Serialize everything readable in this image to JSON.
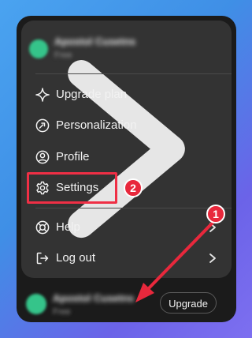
{
  "account": {
    "name": "Apostol Cusetns",
    "plan": "Free"
  },
  "menu": {
    "items": [
      {
        "id": "upgrade",
        "label": "Upgrade plan",
        "icon": "sparkle-icon"
      },
      {
        "id": "personalization",
        "label": "Personalization",
        "icon": "personalization-icon"
      },
      {
        "id": "profile",
        "label": "Profile",
        "icon": "user-icon"
      },
      {
        "id": "settings",
        "label": "Settings",
        "icon": "gear-icon"
      },
      {
        "id": "help",
        "label": "Help",
        "icon": "lifebuoy-icon"
      },
      {
        "id": "logout",
        "label": "Log out",
        "icon": "logout-icon"
      }
    ]
  },
  "bottom": {
    "name": "Apostol Cusetns",
    "plan": "Free",
    "upgrade_label": "Upgrade"
  },
  "annotations": {
    "step1": "1",
    "step2": "2"
  },
  "colors": {
    "annotation_red": "#e8283c",
    "menu_bg": "#333333",
    "panel_bg": "#1b1b1b",
    "avatar_green": "#35c48a"
  }
}
